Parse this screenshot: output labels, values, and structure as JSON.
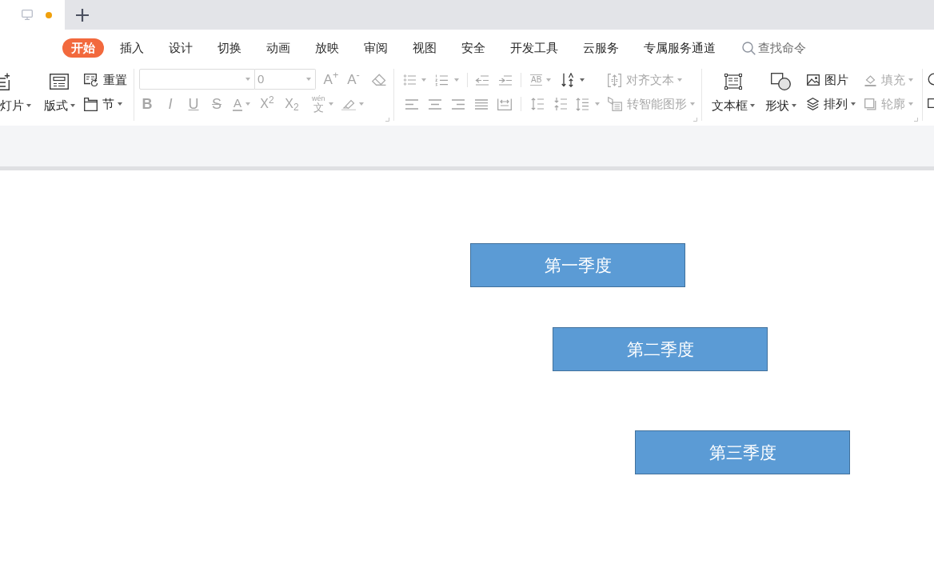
{
  "document_tab": {
    "modified": true
  },
  "ribbon_tabs": [
    {
      "label": "开始",
      "selected": true
    },
    {
      "label": "插入",
      "selected": false
    },
    {
      "label": "设计",
      "selected": false
    },
    {
      "label": "切换",
      "selected": false
    },
    {
      "label": "动画",
      "selected": false
    },
    {
      "label": "放映",
      "selected": false
    },
    {
      "label": "审阅",
      "selected": false
    },
    {
      "label": "视图",
      "selected": false
    },
    {
      "label": "安全",
      "selected": false
    },
    {
      "label": "开发工具",
      "selected": false
    },
    {
      "label": "云服务",
      "selected": false
    },
    {
      "label": "专属服务通道",
      "selected": false
    }
  ],
  "search": {
    "placeholder": "查找命令"
  },
  "slides_group": [
    {
      "kind": "large",
      "label": "灯片",
      "dropdown": true
    },
    {
      "kind": "large",
      "label": "版式",
      "dropdown": true
    },
    {
      "kind": "small",
      "label": "重置",
      "dropdown": false
    },
    {
      "kind": "small",
      "label": "节",
      "dropdown": true
    }
  ],
  "font_group": {
    "disabled": true,
    "font_size": "0",
    "size_buttons": [
      "A$^{+}$",
      "A$^{-}$"
    ],
    "format_buttons": [
      "B",
      "I",
      "U",
      "S"
    ],
    "font_color": "A",
    "scripts": [
      "X$^{2}$",
      "X$_{2}$"
    ],
    "phonetic": {
      "ruby": "wén",
      "base": "文"
    }
  },
  "paragraph_group": {
    "spacing_label": "AB",
    "buttons": [
      {
        "label": "对齐文本",
        "dropdown": true,
        "disabled": true
      },
      {
        "label": "转智能图形",
        "dropdown": true,
        "disabled": true
      }
    ]
  },
  "insert_group": [
    {
      "kind": "large",
      "label": "文本框",
      "dropdown": true,
      "disabled": false
    },
    {
      "kind": "large",
      "label": "形状",
      "dropdown": true,
      "disabled": false
    },
    {
      "kind": "small",
      "label": "图片",
      "dropdown": false,
      "disabled": false
    },
    {
      "kind": "small",
      "label": "排列",
      "dropdown": true,
      "disabled": false
    },
    {
      "kind": "small",
      "label": "填充",
      "dropdown": true,
      "disabled": true
    },
    {
      "kind": "small",
      "label": "轮廓",
      "dropdown": true,
      "disabled": true
    }
  ],
  "slide": {
    "shapes": [
      {
        "text": "第一季度"
      },
      {
        "text": "第二季度"
      },
      {
        "text": "第三季度"
      }
    ]
  }
}
